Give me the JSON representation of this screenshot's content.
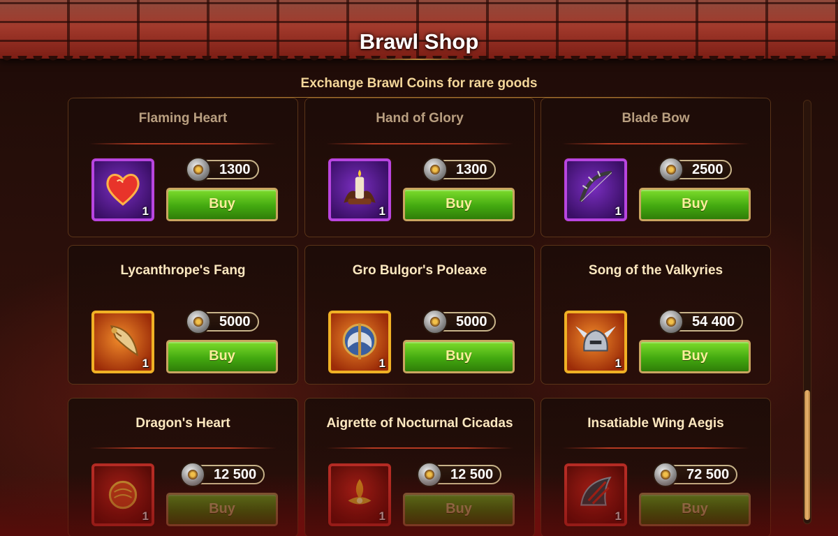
{
  "shop": {
    "title": "Brawl Shop",
    "subtitle": "Exchange Brawl Coins for rare goods",
    "currency_icon": "brawl-coin-icon"
  },
  "items": [
    {
      "name": "Flaming Heart",
      "price": "1300",
      "quantity": "1",
      "buy_label": "Buy",
      "rarity_color": "#b845e0",
      "icon": "flaming-heart-icon"
    },
    {
      "name": "Hand of Glory",
      "price": "1300",
      "quantity": "1",
      "buy_label": "Buy",
      "rarity_color": "#b845e0",
      "icon": "candle-hand-icon"
    },
    {
      "name": "Blade Bow",
      "price": "2500",
      "quantity": "1",
      "buy_label": "Buy",
      "rarity_color": "#b845e0",
      "icon": "blade-bow-icon"
    },
    {
      "name": "Lycanthrope's Fang",
      "price": "5000",
      "quantity": "1",
      "buy_label": "Buy",
      "rarity_color": "#f0b125",
      "icon": "fang-icon"
    },
    {
      "name": "Gro Bulgor's Poleaxe",
      "price": "5000",
      "quantity": "1",
      "buy_label": "Buy",
      "rarity_color": "#f0b125",
      "icon": "poleaxe-icon"
    },
    {
      "name": "Song of the Valkyries",
      "price": "54 400",
      "quantity": "1",
      "buy_label": "Buy",
      "rarity_color": "#f0b125",
      "icon": "valkyrie-helmet-icon"
    },
    {
      "name": "Dragon's Heart",
      "price": "12 500",
      "quantity": "1",
      "buy_label": "Buy",
      "rarity_color": "#e5352d",
      "icon": "dragon-heart-icon"
    },
    {
      "name": "Aigrette of Nocturnal Cicadas",
      "price": "12 500",
      "quantity": "1",
      "buy_label": "Buy",
      "rarity_color": "#e5352d",
      "icon": "aigrette-icon"
    },
    {
      "name": "Insatiable Wing Aegis",
      "price": "72 500",
      "quantity": "1",
      "buy_label": "Buy",
      "rarity_color": "#e5352d",
      "icon": "wing-aegis-icon"
    }
  ]
}
